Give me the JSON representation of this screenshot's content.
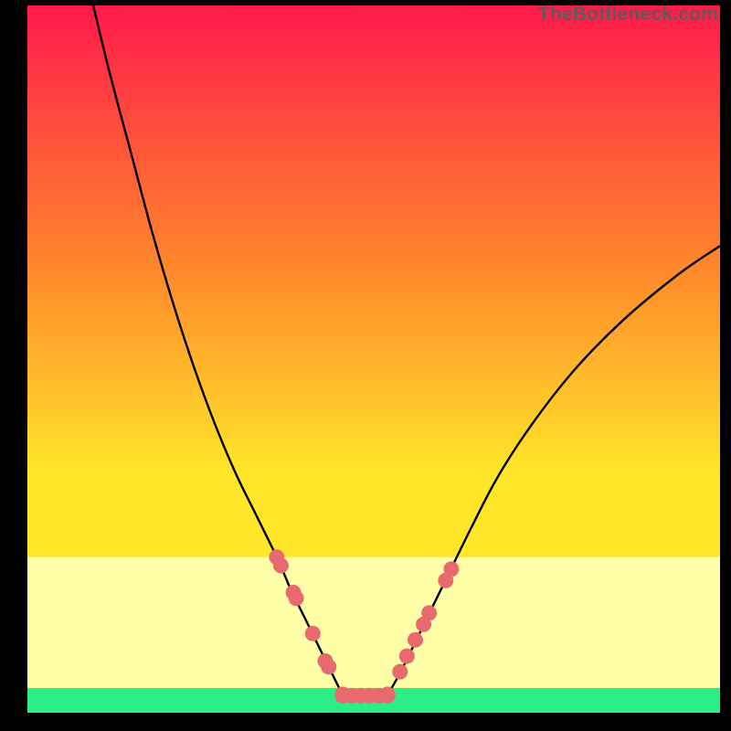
{
  "watermark": "TheBottleneck.com",
  "chart_data": {
    "type": "line",
    "title": "",
    "xlabel": "",
    "ylabel": "",
    "xlim": [
      0,
      100
    ],
    "ylim": [
      0,
      100
    ],
    "gradient_colors": {
      "top": "#ff1a4b",
      "mid1": "#ff8b2a",
      "mid2": "#ffe629",
      "band": "#ffffa8",
      "bottom": "#2bee86"
    },
    "series": [
      {
        "name": "left-curve",
        "x": [
          9.5,
          12,
          15,
          18,
          21,
          24,
          27,
          30,
          33,
          36,
          38,
          40,
          42,
          44,
          45.5
        ],
        "values": [
          100,
          90,
          79,
          68,
          58,
          49,
          41,
          34,
          28,
          22,
          17.5,
          13.5,
          9.5,
          5.5,
          2.5
        ]
      },
      {
        "name": "right-curve",
        "x": [
          52,
          54,
          57,
          60,
          64,
          68,
          73,
          79,
          86,
          94,
          100
        ],
        "values": [
          2.5,
          6,
          12,
          18,
          26,
          33.5,
          41,
          48.5,
          55.5,
          62,
          66
        ]
      },
      {
        "name": "left-markers",
        "x": [
          36.0,
          36.6,
          38.4,
          38.8,
          41.2,
          43.0,
          43.5,
          45.5
        ],
        "values": [
          22.0,
          20.8,
          17.0,
          16.2,
          11.2,
          7.3,
          6.5,
          2.6
        ]
      },
      {
        "name": "right-markers",
        "x": [
          52.0,
          53.8,
          54.8,
          56.0,
          57.2,
          58.0,
          60.4,
          61.2
        ],
        "values": [
          2.6,
          5.8,
          8.0,
          10.3,
          12.5,
          14.1,
          18.7,
          20.3
        ]
      },
      {
        "name": "bottom-markers",
        "x": [
          45.5,
          46.8,
          48.1,
          49.4,
          50.7,
          52.0
        ],
        "values": [
          2.4,
          2.4,
          2.4,
          2.4,
          2.4,
          2.4
        ]
      }
    ]
  }
}
